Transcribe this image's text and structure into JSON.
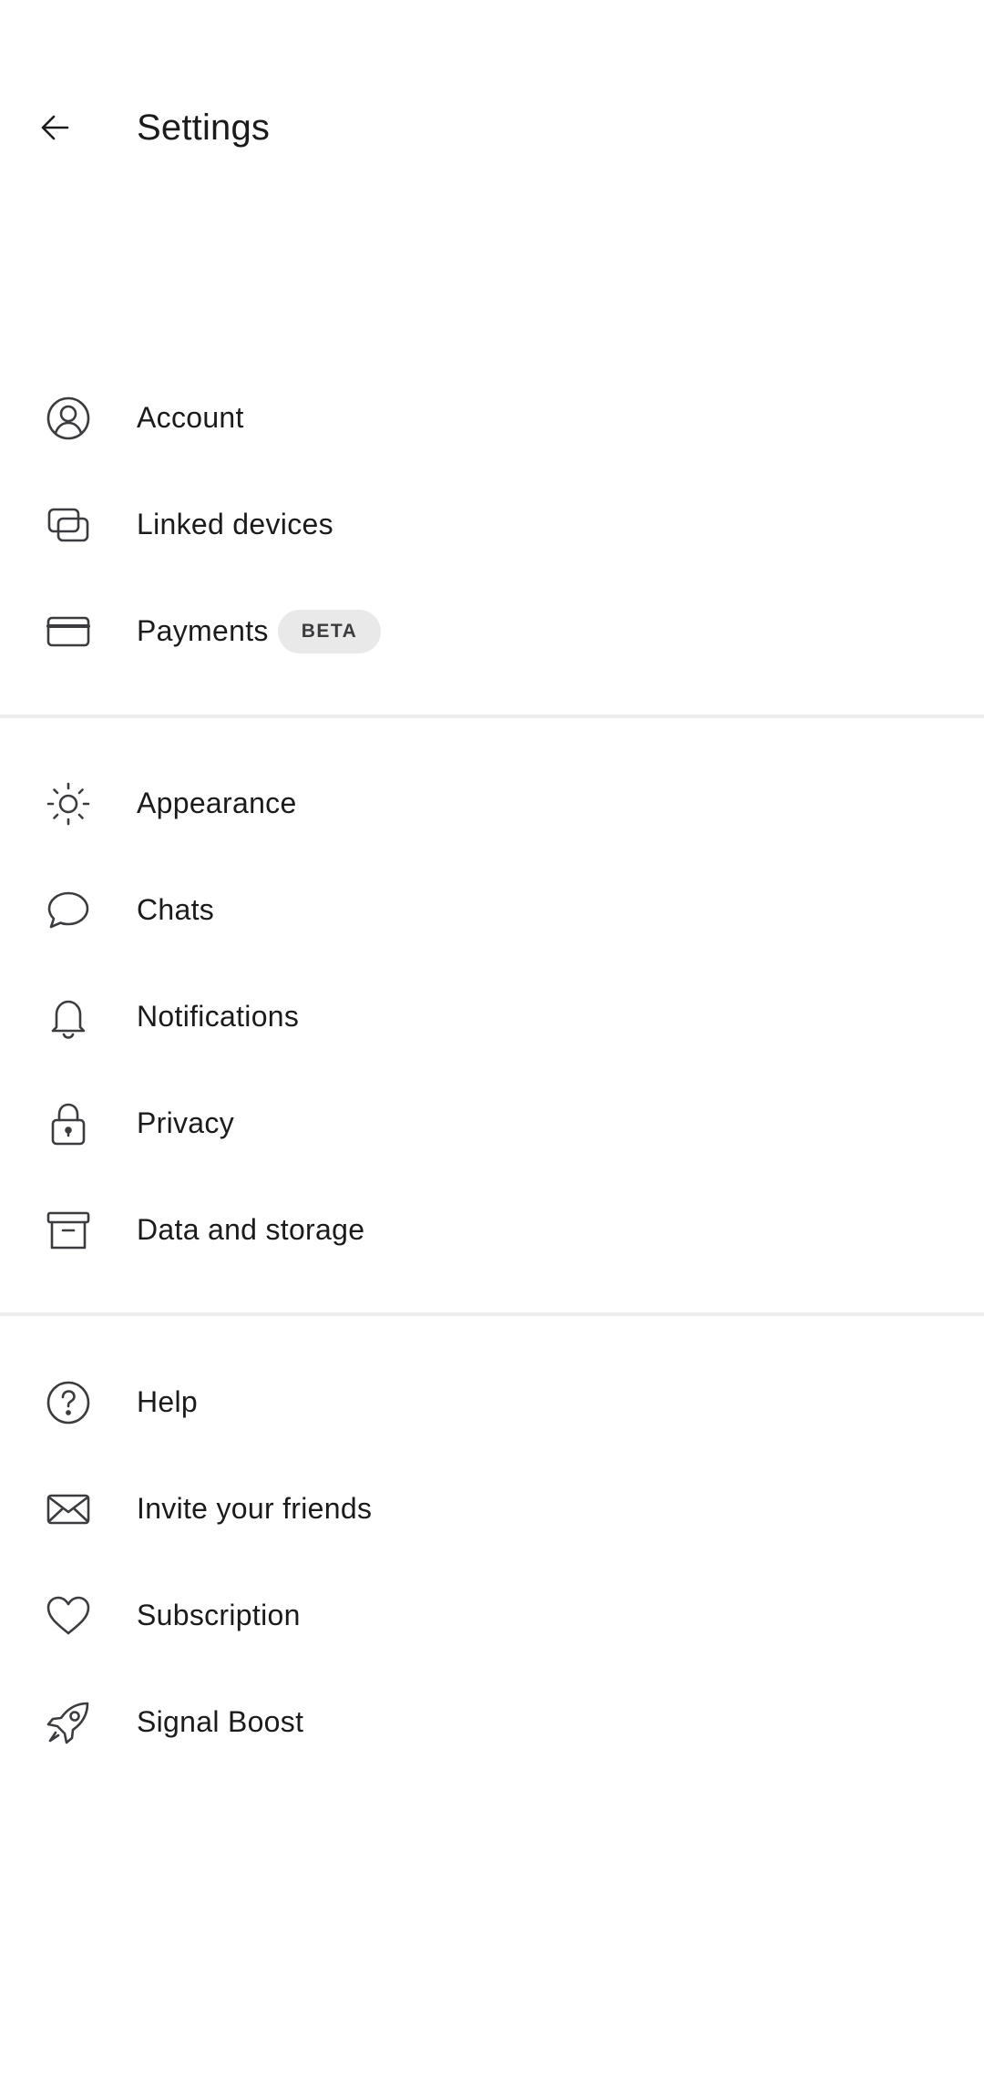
{
  "header": {
    "title": "Settings",
    "back_icon": "arrow-left-icon"
  },
  "groups": [
    {
      "items": [
        {
          "label": "Account",
          "icon": "account-icon"
        },
        {
          "label": "Linked devices",
          "icon": "linked-devices-icon"
        },
        {
          "label": "Payments",
          "icon": "card-icon",
          "badge": "BETA"
        }
      ]
    },
    {
      "items": [
        {
          "label": "Appearance",
          "icon": "sun-icon"
        },
        {
          "label": "Chats",
          "icon": "chat-bubble-icon"
        },
        {
          "label": "Notifications",
          "icon": "bell-icon"
        },
        {
          "label": "Privacy",
          "icon": "lock-icon"
        },
        {
          "label": "Data and storage",
          "icon": "archive-box-icon"
        }
      ]
    },
    {
      "items": [
        {
          "label": "Help",
          "icon": "help-circle-icon"
        },
        {
          "label": "Invite your friends",
          "icon": "envelope-icon"
        },
        {
          "label": "Subscription",
          "icon": "heart-icon"
        },
        {
          "label": "Signal Boost",
          "icon": "rocket-icon"
        }
      ]
    }
  ],
  "colors": {
    "text": "#1b1b1d",
    "icon": "#3c3c40",
    "badge_bg": "#e9e9e9",
    "divider": "#ececec"
  }
}
